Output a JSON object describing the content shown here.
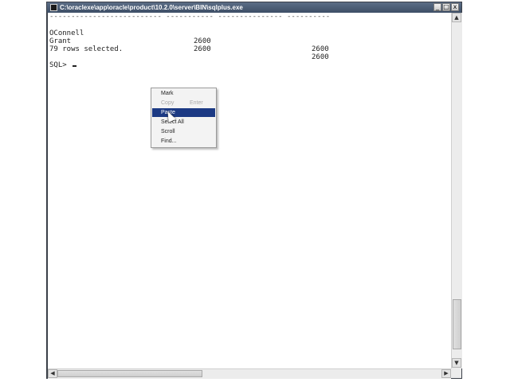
{
  "window": {
    "title": "C:\\oraclexe\\app\\oracle\\product\\10.2.0\\server\\BIN\\sqlplus.exe",
    "minimize_glyph": "_",
    "restore_glyph": "□",
    "close_glyph": "x"
  },
  "console": {
    "separator": "-------------------------- ----------- --------------- ----------",
    "rows": [
      {
        "last_name": "OConnell",
        "col2": "2600",
        "col3": "2600"
      },
      {
        "last_name": "Grant",
        "col2": "2600",
        "col3": "2600"
      }
    ],
    "summary": "79 rows selected.",
    "prompt": "SQL> "
  },
  "context_menu": {
    "items": [
      {
        "label": "Mark",
        "shortcut": "",
        "state": "normal"
      },
      {
        "label": "Copy",
        "shortcut": "Enter",
        "state": "disabled"
      },
      {
        "label": "Paste",
        "shortcut": "",
        "state": "active"
      },
      {
        "label": "Select All",
        "shortcut": "",
        "state": "normal"
      },
      {
        "label": "Scroll",
        "shortcut": "",
        "state": "normal"
      },
      {
        "label": "Find...",
        "shortcut": "",
        "state": "normal"
      }
    ]
  },
  "scrollbars": {
    "up_arrow": "▲",
    "down_arrow": "▼",
    "left_arrow": "◀",
    "right_arrow": "▶"
  }
}
